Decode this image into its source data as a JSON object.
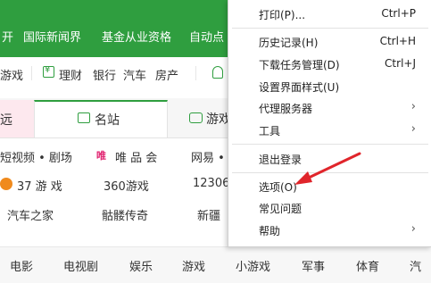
{
  "nav": {
    "items": [
      "开",
      "国际新闻界",
      "基金从业资格",
      "自动点"
    ]
  },
  "quicklinks": {
    "partial": "游戏",
    "items": [
      "理财",
      "银行",
      "汽车",
      "房产"
    ]
  },
  "tabs": {
    "left_partial": "远",
    "active": "名站",
    "right_partial": "游戏"
  },
  "sites": {
    "row1": [
      "短视频 • 剧场",
      "唯 品 会",
      "网易 •"
    ],
    "vip_badge": "唯",
    "row2": [
      "37 游 戏",
      "360游戏",
      "12306"
    ],
    "row3": [
      "汽车之家",
      "骷髅传奇",
      "新疆"
    ]
  },
  "categories": [
    "电影",
    "电视剧",
    "娱乐",
    "游戏",
    "小游戏",
    "军事",
    "体育",
    "汽"
  ],
  "menu": {
    "items": [
      {
        "label": "打印(P)...",
        "shortcut": "Ctrl+P"
      },
      {
        "label": "历史记录(H)",
        "shortcut": "Ctrl+H"
      },
      {
        "label": "下载任务管理(D)",
        "shortcut": "Ctrl+J"
      },
      {
        "label": "设置界面样式(U)",
        "shortcut": ""
      },
      {
        "label": "代理服务器",
        "shortcut": "",
        "submenu": true
      },
      {
        "label": "工具",
        "shortcut": "",
        "submenu": true
      },
      {
        "label": "退出登录",
        "shortcut": ""
      },
      {
        "label": "选项(O)",
        "shortcut": ""
      },
      {
        "label": "常见问题",
        "shortcut": ""
      },
      {
        "label": "帮助",
        "shortcut": "",
        "submenu": true
      }
    ],
    "submenu_arrow": "›"
  },
  "colors": {
    "brand_green": "#2f9e3f",
    "annotation_red": "#e0252b",
    "vip_pink": "#e0216f"
  }
}
